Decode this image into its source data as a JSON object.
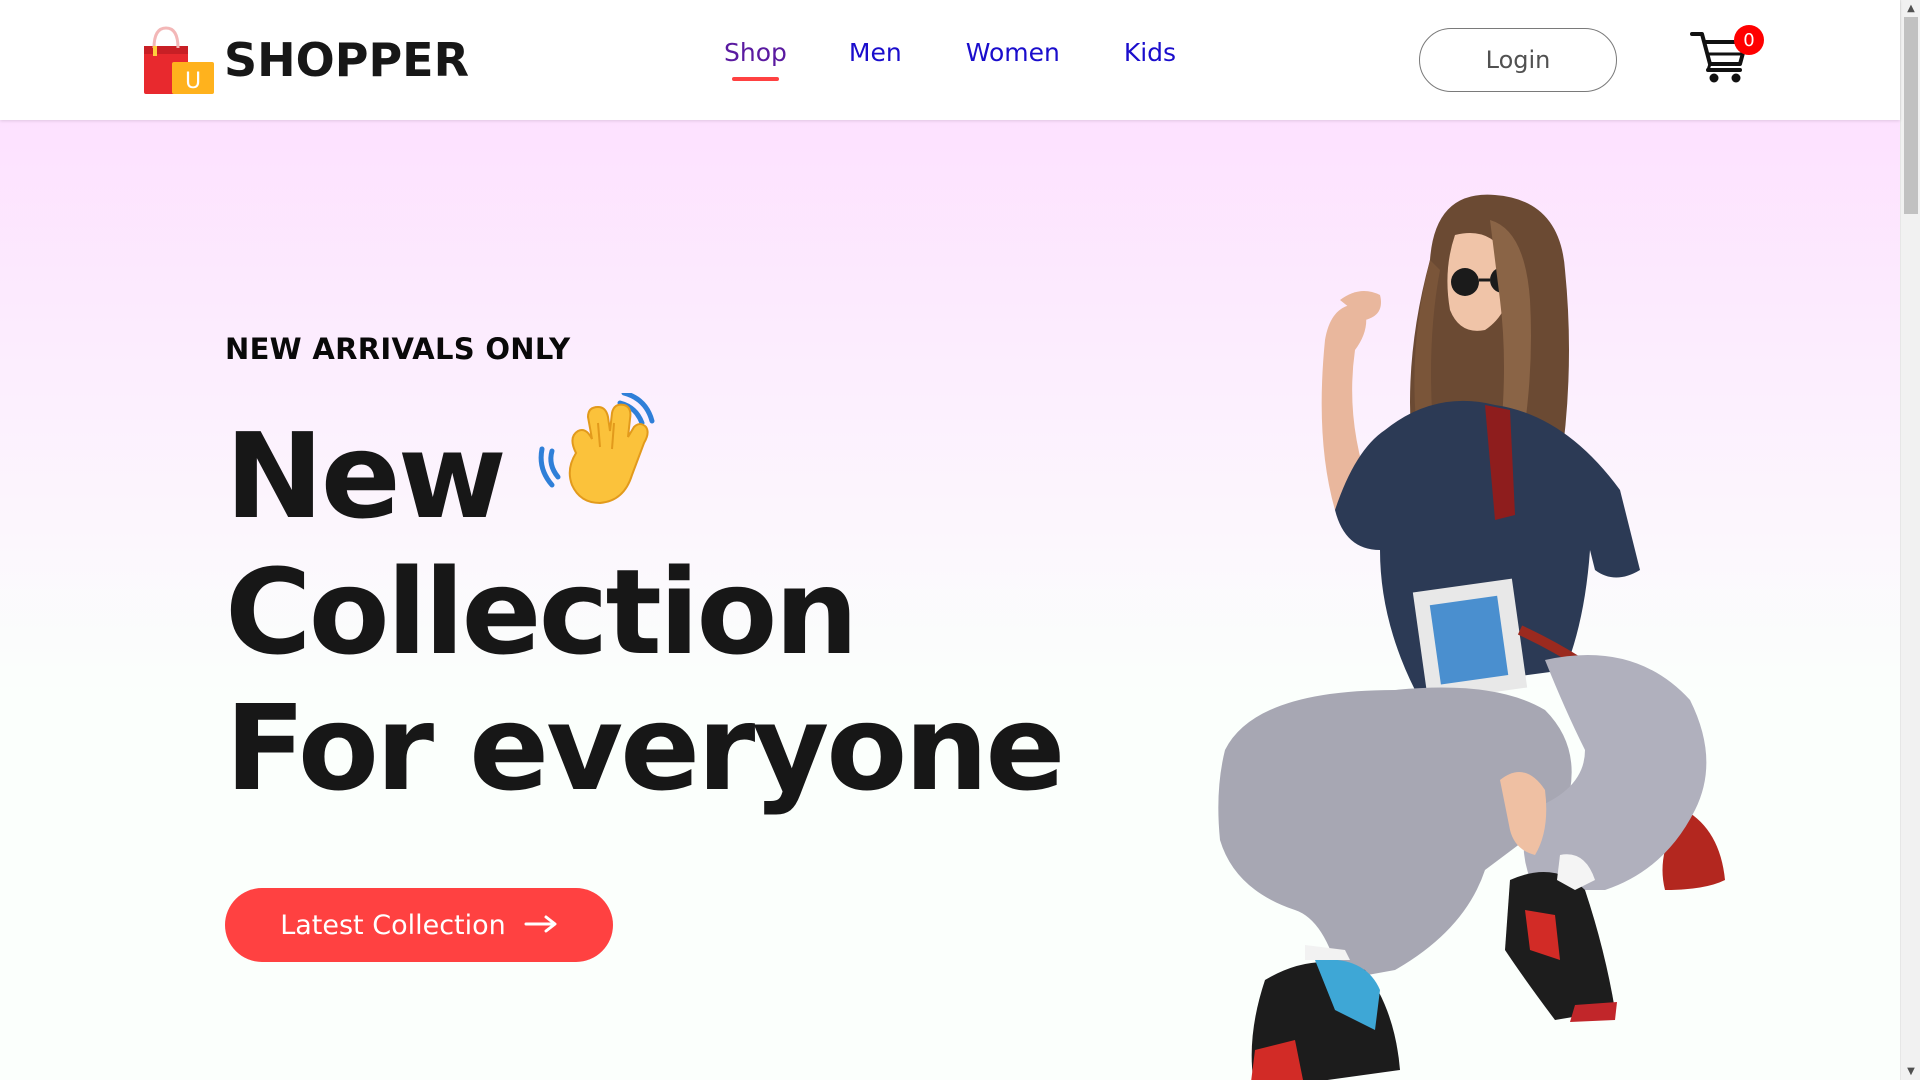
{
  "brand": {
    "logo_text": "SHOPPER",
    "logo_bag_letter": "U"
  },
  "nav": {
    "items": [
      {
        "label": "Shop",
        "active": true
      },
      {
        "label": "Men",
        "active": false
      },
      {
        "label": "Women",
        "active": false
      },
      {
        "label": "Kids",
        "active": false
      }
    ]
  },
  "header": {
    "login_label": "Login",
    "cart_count": "0"
  },
  "hero": {
    "tagline": "NEW ARRIVALS ONLY",
    "heading_lines": [
      "New",
      "Collection",
      "For everyone"
    ],
    "cta_label": "Latest Collection"
  },
  "colors": {
    "accent": "#ff4141",
    "nav_link": "#1a0dcc",
    "hero_gradient_top": "#fde1ff"
  },
  "icons": {
    "logo": "shopping-bag-icon",
    "cart": "cart-icon",
    "hand": "waving-hand-icon",
    "cta_arrow": "arrow-right-icon"
  }
}
